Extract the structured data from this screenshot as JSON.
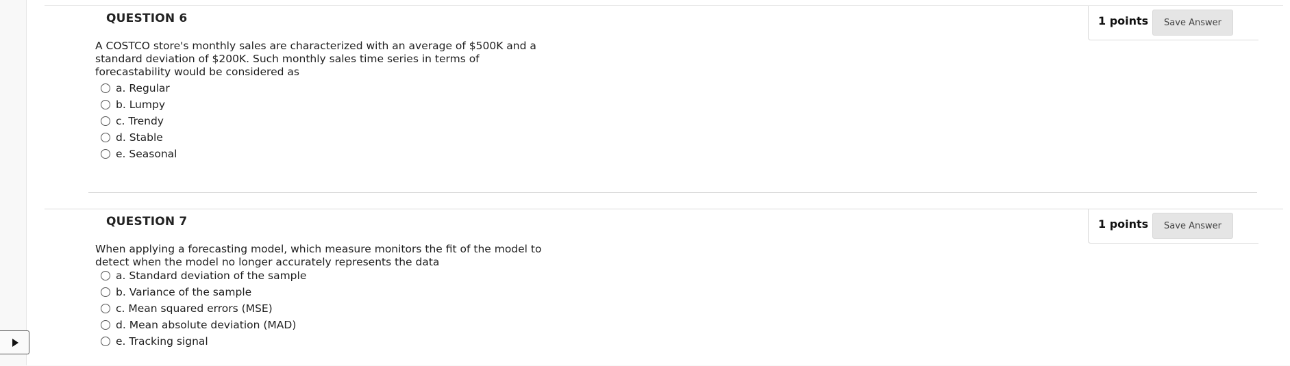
{
  "questions": [
    {
      "title": "QUESTION 6",
      "points": "1 points",
      "save_label": "Save Answer",
      "text": "A COSTCO store's monthly sales are characterized with an average of $500K and a standard deviation of $200K. Such monthly sales time series in terms of forecastability would be considered as",
      "options": [
        "a. Regular",
        "b. Lumpy",
        "c. Trendy",
        "d. Stable",
        "e. Seasonal"
      ]
    },
    {
      "title": "QUESTION 7",
      "points": "1 points",
      "save_label": "Save Answer",
      "text": "When applying a forecasting model, which measure monitors the fit of the model to detect when the model no longer accurately represents the data",
      "options": [
        "a. Standard deviation of the sample",
        "b. Variance of the sample",
        "c. Mean squared errors (MSE)",
        "d. Mean absolute deviation (MAD)",
        "e. Tracking signal"
      ]
    }
  ],
  "icons": {
    "play": "play-icon",
    "radio": "radio-button"
  }
}
